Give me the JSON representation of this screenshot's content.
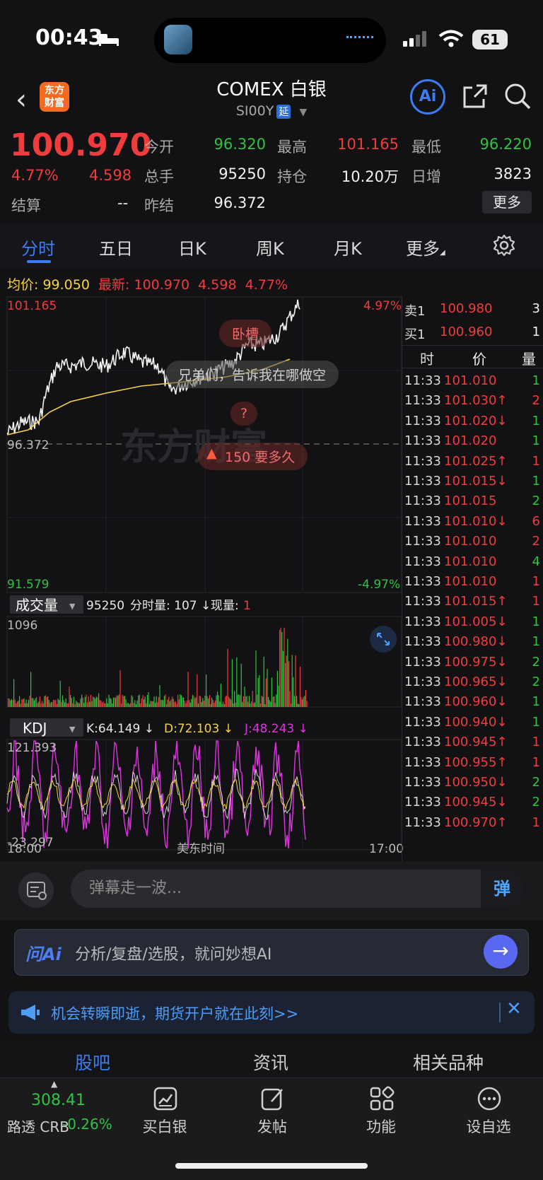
{
  "status_bar": {
    "time": "00:43",
    "battery": "61"
  },
  "header": {
    "logo_line1": "东方",
    "logo_line2": "财富",
    "title": "COMEX 白银",
    "code": "SI00Y",
    "code_tag": "延",
    "ai_label": "Ai"
  },
  "quote": {
    "price": "100.970",
    "change_pct": "4.77%",
    "change": "4.598",
    "settle_label": "结算",
    "settle_value": "--",
    "open_label": "今开",
    "open_value": "96.320",
    "high_label": "最高",
    "high_value": "101.165",
    "low_label": "最低",
    "low_value": "96.220",
    "volume_label": "总手",
    "volume_value": "95250",
    "oi_label": "持仓",
    "oi_value": "10.20万",
    "daily_inc_label": "日增",
    "daily_inc_value": "3823",
    "prev_settle_label": "昨结",
    "prev_settle_value": "96.372",
    "more_label": "更多"
  },
  "tabs": [
    "分时",
    "五日",
    "日K",
    "周K",
    "月K",
    "更多"
  ],
  "info_line": {
    "avg_label": "均价:",
    "avg_value": "99.050",
    "last_label": "最新:",
    "last_value": "100.970",
    "chg": "4.598",
    "pct": "4.77%"
  },
  "chart_labels": {
    "top_price": "101.165",
    "top_pct": "4.97%",
    "mid_price": "96.372",
    "bottom_price": "91.579",
    "bottom_pct": "-4.97%",
    "watermark": "东方财富",
    "vol_selector": "成交量",
    "vol_info_total": "95250",
    "vol_info_label": "分时量: 107 ↓",
    "vol_cur_label": "现量:",
    "vol_cur_value": "1",
    "vol_max": "1096",
    "kdj_selector": "KDJ",
    "kdj_k": "K:64.149 ↓",
    "kdj_d": "D:72.103 ↓",
    "kdj_j": "J:48.243 ↓",
    "kdj_top": "121.393",
    "kdj_bottom": "-23.297",
    "x_start": "18:00",
    "x_mid": "美东时间",
    "x_end": "17:00"
  },
  "bubbles": {
    "b1": "卧槽",
    "b2": "兄弟们，告诉我在哪做空",
    "b3": "?",
    "b4": "150 要多久"
  },
  "order_book": {
    "ask_label": "卖1",
    "ask_price": "100.980",
    "ask_qty": "3",
    "bid_label": "买1",
    "bid_price": "100.960",
    "bid_qty": "1",
    "col_time": "时",
    "col_price": "价",
    "col_qty": "量"
  },
  "ticks": [
    {
      "t": "11:33",
      "p": "101.010",
      "v": "1",
      "pc": "red",
      "vc": "green"
    },
    {
      "t": "11:33",
      "p": "101.030↑",
      "v": "2",
      "pc": "red",
      "vc": "red"
    },
    {
      "t": "11:33",
      "p": "101.020↓",
      "v": "1",
      "pc": "red",
      "vc": "green"
    },
    {
      "t": "11:33",
      "p": "101.020",
      "v": "1",
      "pc": "red",
      "vc": "green"
    },
    {
      "t": "11:33",
      "p": "101.025↑",
      "v": "1",
      "pc": "red",
      "vc": "red"
    },
    {
      "t": "11:33",
      "p": "101.015↓",
      "v": "1",
      "pc": "red",
      "vc": "green"
    },
    {
      "t": "11:33",
      "p": "101.015",
      "v": "2",
      "pc": "red",
      "vc": "green"
    },
    {
      "t": "11:33",
      "p": "101.010↓",
      "v": "6",
      "pc": "red",
      "vc": "red"
    },
    {
      "t": "11:33",
      "p": "101.010",
      "v": "2",
      "pc": "red",
      "vc": "red"
    },
    {
      "t": "11:33",
      "p": "101.010",
      "v": "4",
      "pc": "red",
      "vc": "green"
    },
    {
      "t": "11:33",
      "p": "101.010",
      "v": "1",
      "pc": "red",
      "vc": "red"
    },
    {
      "t": "11:33",
      "p": "101.015↑",
      "v": "1",
      "pc": "red",
      "vc": "red"
    },
    {
      "t": "11:33",
      "p": "101.005↓",
      "v": "1",
      "pc": "red",
      "vc": "green"
    },
    {
      "t": "11:33",
      "p": "100.980↓",
      "v": "1",
      "pc": "red",
      "vc": "green"
    },
    {
      "t": "11:33",
      "p": "100.975↓",
      "v": "2",
      "pc": "red",
      "vc": "green"
    },
    {
      "t": "11:33",
      "p": "100.965↓",
      "v": "2",
      "pc": "red",
      "vc": "green"
    },
    {
      "t": "11:33",
      "p": "100.960↓",
      "v": "1",
      "pc": "red",
      "vc": "green"
    },
    {
      "t": "11:33",
      "p": "100.940↓",
      "v": "1",
      "pc": "red",
      "vc": "green"
    },
    {
      "t": "11:33",
      "p": "100.945↑",
      "v": "1",
      "pc": "red",
      "vc": "red"
    },
    {
      "t": "11:33",
      "p": "100.955↑",
      "v": "1",
      "pc": "red",
      "vc": "red"
    },
    {
      "t": "11:33",
      "p": "100.950↓",
      "v": "2",
      "pc": "red",
      "vc": "green"
    },
    {
      "t": "11:33",
      "p": "100.945↓",
      "v": "2",
      "pc": "red",
      "vc": "green"
    },
    {
      "t": "11:33",
      "p": "100.970↑",
      "v": "1",
      "pc": "red",
      "vc": "red"
    }
  ],
  "comment": {
    "placeholder": "弹幕走一波...",
    "danmu": "弹"
  },
  "ai_bar": {
    "logo": "问Ai",
    "text": "分析/复盘/选股，就问妙想AI"
  },
  "promo": {
    "text": "机会转瞬即逝，期货开户就在此刻>>"
  },
  "bottom_tabs": [
    "股吧",
    "资讯",
    "相关品种"
  ],
  "nav": {
    "index_value": "308.41",
    "index_name": "路透 CRB",
    "index_pct": "-0.26%",
    "items": [
      "买白银",
      "发帖",
      "功能",
      "设自选"
    ]
  },
  "colors": {
    "up": "#f03c3c",
    "down": "#2fc43f",
    "accent": "#3d7cf0",
    "avg": "#f5d442",
    "kdj_j": "#e033e0"
  }
}
